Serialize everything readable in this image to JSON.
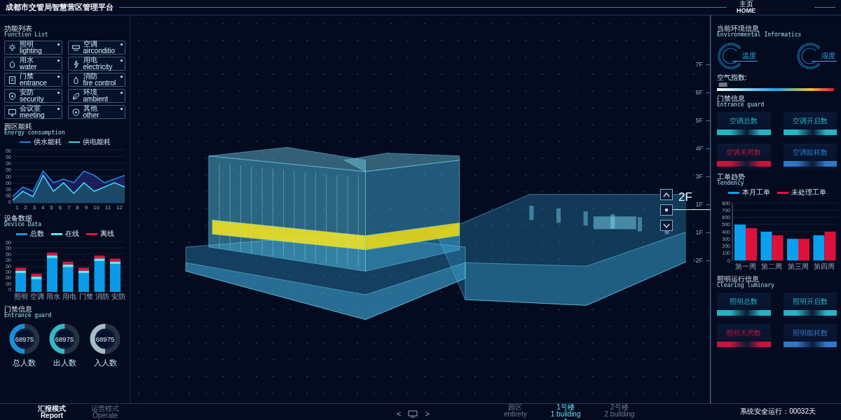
{
  "header": {
    "title": "成都市交管局智慧营区管理平台",
    "home": {
      "zh": "主页",
      "en": "HOME"
    }
  },
  "function_list": {
    "title": "功能列表",
    "subtitle": "Function List",
    "items": [
      {
        "zh": "照明",
        "en": "lighting"
      },
      {
        "zh": "空调",
        "en": "airconditio"
      },
      {
        "zh": "用水",
        "en": "water"
      },
      {
        "zh": "用电",
        "en": "electricity"
      },
      {
        "zh": "门禁",
        "en": "entrance"
      },
      {
        "zh": "消防",
        "en": "fire control"
      },
      {
        "zh": "安防",
        "en": "security"
      },
      {
        "zh": "环境",
        "en": "ambient"
      },
      {
        "zh": "会议室",
        "en": "meeting"
      },
      {
        "zh": "其他",
        "en": "other"
      }
    ]
  },
  "energy": {
    "title": "园区能耗",
    "subtitle": "Energy consumption",
    "legend": [
      {
        "name": "供水能耗",
        "color": "#1c86e0"
      },
      {
        "name": "供电能耗",
        "color": "#3cd6f0"
      }
    ],
    "y_labels": [
      "00",
      "00",
      "00",
      "00",
      "00",
      "00",
      "00",
      "00",
      "0"
    ],
    "x_labels": [
      "1",
      "2",
      "3",
      "4",
      "5",
      "6",
      "7",
      "8",
      "9",
      "10",
      "11",
      "12"
    ]
  },
  "devices": {
    "title": "设备数据",
    "subtitle": "Device Data",
    "legend": [
      {
        "name": "总数",
        "color": "#0a9be8"
      },
      {
        "name": "在线",
        "color": "#5ee8f6"
      },
      {
        "name": "离线",
        "color": "#e0143c"
      }
    ],
    "y_labels": [
      "00",
      "00",
      "00",
      "00",
      "00",
      "00",
      "00",
      "00",
      "0"
    ],
    "categories": [
      "照明",
      "空调",
      "用水",
      "用电",
      "门禁",
      "消防",
      "安防"
    ]
  },
  "entrance": {
    "title": "门禁信息",
    "subtitle": "Entrance guard",
    "rings": [
      {
        "value": "68975",
        "label": "总人数",
        "level": 0.5,
        "color": "#1a8fd6"
      },
      {
        "value": "68975",
        "label": "出人数",
        "level": 0.5,
        "color": "#35b8c6"
      },
      {
        "value": "68975",
        "label": "入人数",
        "level": 0.5,
        "color": "#a6bcc4"
      }
    ]
  },
  "floors": {
    "labels": [
      "7F",
      "6F",
      "5F",
      "4F",
      "3F",
      "1F",
      "1F",
      "-2F"
    ],
    "selected": "2F"
  },
  "environment": {
    "title": "当前环境信息",
    "subtitle": "Environmental Informatics",
    "gauges": [
      "温度",
      "湿度"
    ],
    "air_index": {
      "label": "空气指数:",
      "level": 0.03
    }
  },
  "entrance_right": {
    "title": "门禁信息",
    "subtitle": "Entrance guard",
    "stats": [
      {
        "label": "空调总数",
        "color": "#24b4c4"
      },
      {
        "label": "空调开启数",
        "color": "#24b4c4"
      },
      {
        "label": "空调关闭数",
        "color": "#c8143c"
      },
      {
        "label": "空调能耗数",
        "color": "#2f78c8"
      }
    ]
  },
  "tendency": {
    "title": "工单趋势",
    "subtitle": "Tendency",
    "chart_data": {
      "type": "bar",
      "categories": [
        "第一周",
        "第二周",
        "第三周",
        "第四周"
      ],
      "series": [
        {
          "name": "本月工单",
          "color": "#0aa0f0",
          "values": [
            500,
            400,
            300,
            350
          ]
        },
        {
          "name": "未处理工单",
          "color": "#e0103c",
          "values": [
            450,
            350,
            300,
            400
          ]
        }
      ],
      "ylim": [
        0,
        800
      ],
      "grid": true,
      "yticks": [
        0,
        100,
        200,
        300,
        400,
        500,
        600,
        700,
        800
      ]
    }
  },
  "lighting": {
    "title": "照明运行信息",
    "subtitle": "Clearing luminary",
    "stats": [
      {
        "label": "照明总数",
        "color": "#24b4c4"
      },
      {
        "label": "照明开启数",
        "color": "#24b4c4"
      },
      {
        "label": "照明关闭数",
        "color": "#c8143c"
      },
      {
        "label": "照明能耗数",
        "color": "#2f78c8"
      }
    ]
  },
  "footer": {
    "modes": [
      {
        "zh": "汇报模式",
        "en": "Report",
        "selected": true
      },
      {
        "zh": "运营模式",
        "en": "Operate",
        "selected": false
      }
    ],
    "nav": [
      "<",
      ">"
    ],
    "tabs": [
      {
        "zh": "园区",
        "en": "entirety",
        "selected": false
      },
      {
        "zh": "1号楼",
        "en": "1 building",
        "selected": true
      },
      {
        "zh": "2号楼",
        "en": "2 building",
        "selected": false
      }
    ],
    "status": "系统安全运行：00032天"
  }
}
